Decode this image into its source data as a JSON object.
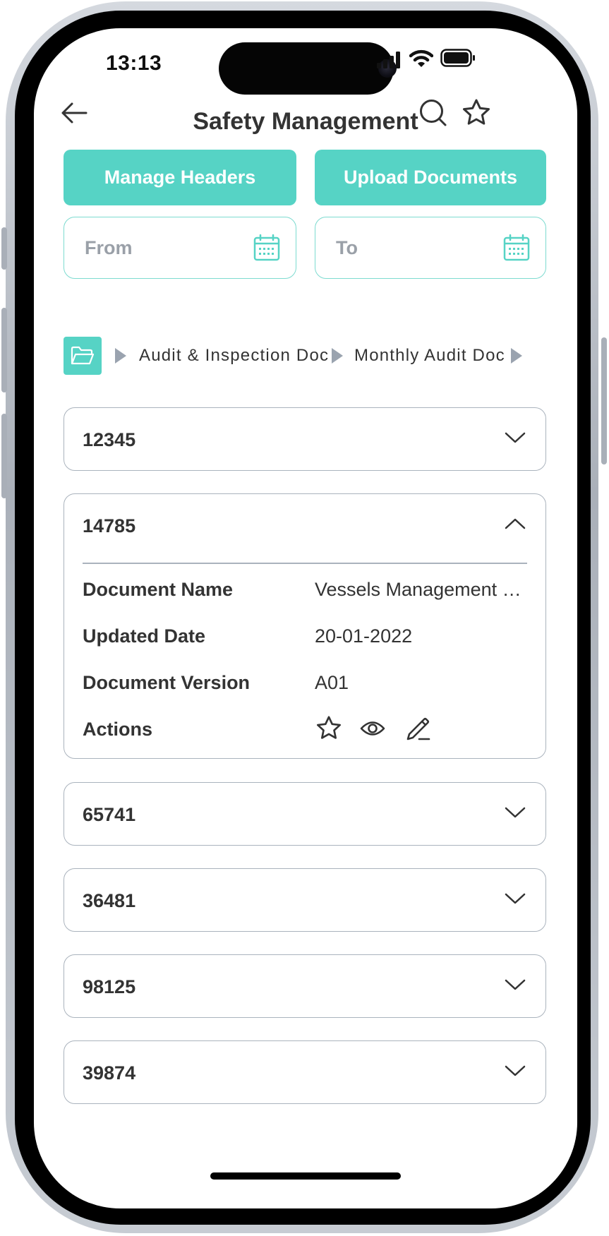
{
  "status_bar": {
    "time": "13:13"
  },
  "header": {
    "title": "Safety Management"
  },
  "actions": {
    "manage_headers": "Manage Headers",
    "upload_documents": "Upload Documents"
  },
  "date_filter": {
    "from_placeholder": "From",
    "to_placeholder": "To"
  },
  "breadcrumb": {
    "items": [
      "Audit & Inspection Doc",
      "Monthly Audit Doc"
    ]
  },
  "documents": [
    {
      "id": "12345",
      "expanded": false
    },
    {
      "id": "14785",
      "expanded": true,
      "fields": {
        "name_label": "Document Name",
        "name_value": "Vessels Management Policy",
        "date_label": "Updated Date",
        "date_value": "20-01-2022",
        "version_label": "Document Version",
        "version_value": "A01",
        "actions_label": "Actions"
      }
    },
    {
      "id": "65741",
      "expanded": false
    },
    {
      "id": "36481",
      "expanded": false
    },
    {
      "id": "98125",
      "expanded": false
    },
    {
      "id": "39874",
      "expanded": false
    }
  ],
  "colors": {
    "accent": "#56d3c5",
    "border": "#aab3bd",
    "text": "#333333"
  },
  "icons": [
    "back-arrow-icon",
    "search-icon",
    "star-icon",
    "calendar-icon",
    "folder-icon",
    "chevron-down-icon",
    "chevron-up-icon",
    "eye-icon",
    "edit-icon"
  ]
}
